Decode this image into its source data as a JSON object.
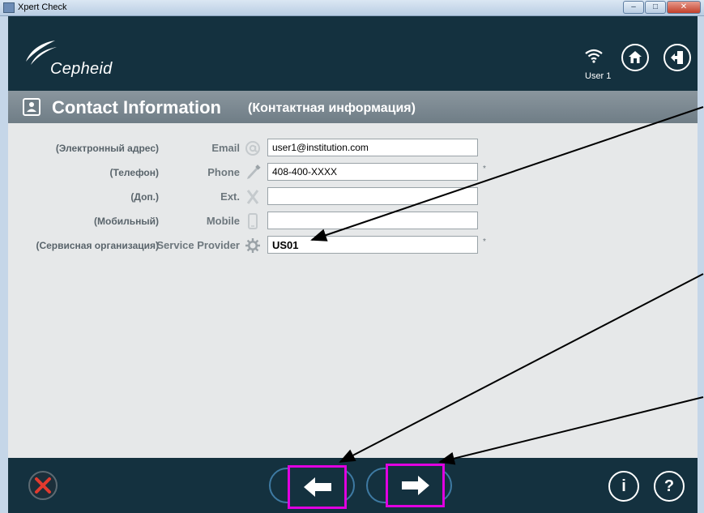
{
  "window": {
    "title": "Xpert Check",
    "min_glyph": "–",
    "max_glyph": "□",
    "close_glyph": "✕"
  },
  "header": {
    "logo_text": "Cepheid",
    "user": "User 1"
  },
  "section": {
    "title": "Contact Information",
    "title_ru": "(Контактная информация)"
  },
  "form": {
    "rows": [
      {
        "label_ru": "(Электронный адрес)",
        "label": "Email",
        "icon": "at-icon",
        "value": "user1@institution.com",
        "required": false
      },
      {
        "label_ru": "(Телефон)",
        "label": "Phone",
        "icon": "phone-icon",
        "value": "408-400-XXXX",
        "required": true
      },
      {
        "label_ru": "(Доп.)",
        "label": "Ext.",
        "icon": "ext-x-icon",
        "value": "",
        "required": false
      },
      {
        "label_ru": "(Мобильный)",
        "label": "Mobile",
        "icon": "mobile-icon",
        "value": "",
        "required": false
      },
      {
        "label_ru": "(Сервисная организация)",
        "label": "Service Provider",
        "icon": "gear-icon",
        "value": "US01",
        "required": true
      }
    ],
    "required_mark": "*"
  },
  "footer": {
    "info_glyph": "i",
    "help_glyph": "?"
  },
  "colors": {
    "header_bg": "#14313f",
    "section_bar": "#7c8992",
    "content_bg": "#e6e8e9",
    "highlight": "#e000e0"
  }
}
